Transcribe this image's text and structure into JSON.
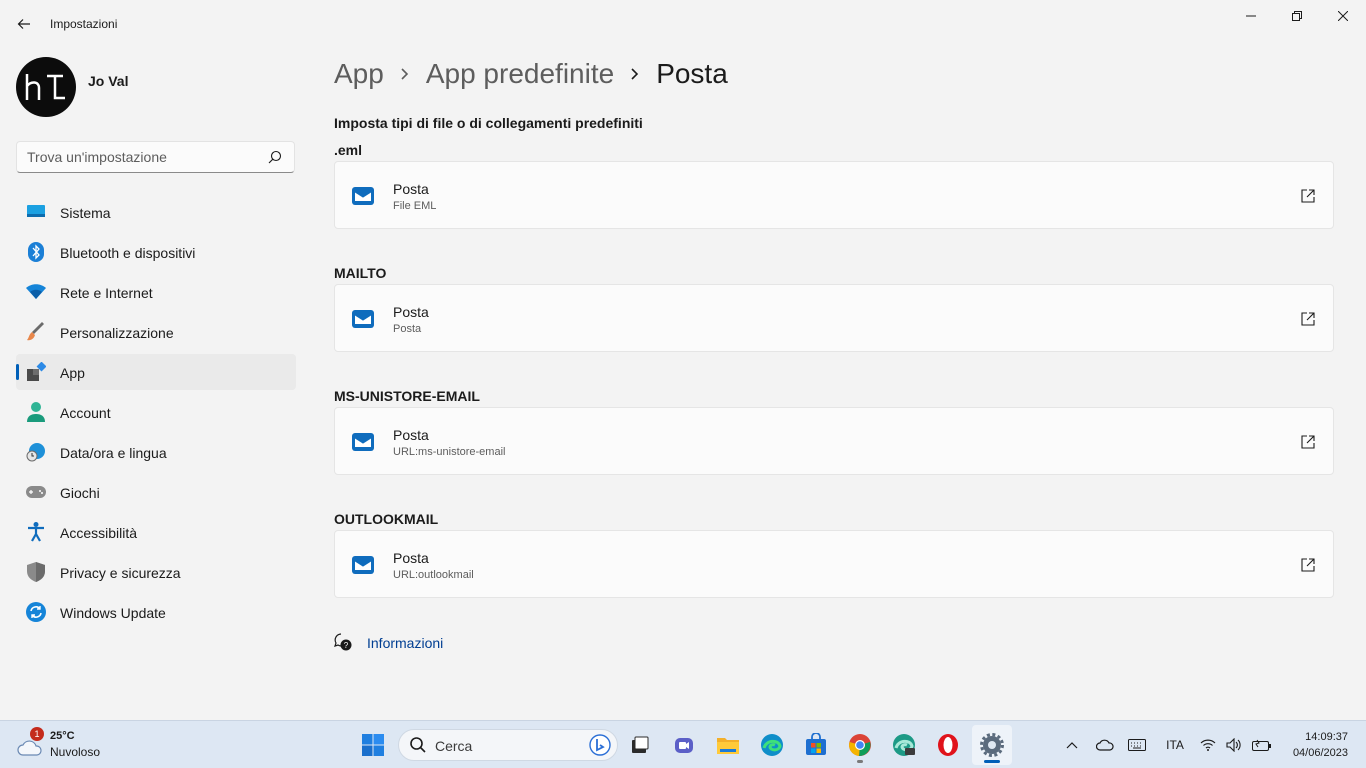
{
  "window": {
    "title": "Impostazioni"
  },
  "profile": {
    "name": "Jo Val"
  },
  "search": {
    "placeholder": "Trova un'impostazione"
  },
  "sidebar": {
    "items": [
      {
        "label": "Sistema",
        "icon": "system-icon"
      },
      {
        "label": "Bluetooth e dispositivi",
        "icon": "bluetooth-icon"
      },
      {
        "label": "Rete e Internet",
        "icon": "wifi-icon"
      },
      {
        "label": "Personalizzazione",
        "icon": "brush-icon"
      },
      {
        "label": "App",
        "icon": "apps-icon",
        "active": true
      },
      {
        "label": "Account",
        "icon": "account-icon"
      },
      {
        "label": "Data/ora e lingua",
        "icon": "time-language-icon"
      },
      {
        "label": "Giochi",
        "icon": "gamepad-icon"
      },
      {
        "label": "Accessibilità",
        "icon": "accessibility-icon"
      },
      {
        "label": "Privacy e sicurezza",
        "icon": "shield-icon"
      },
      {
        "label": "Windows Update",
        "icon": "update-icon"
      }
    ]
  },
  "breadcrumb": {
    "items": [
      "App",
      "App predefinite",
      "Posta"
    ]
  },
  "main": {
    "section_title": "Imposta tipi di file o di collegamenti predefiniti",
    "groups": [
      {
        "label": ".eml",
        "app": "Posta",
        "detail": "File EML"
      },
      {
        "label": "MAILTO",
        "app": "Posta",
        "detail": "Posta"
      },
      {
        "label": "MS-UNISTORE-EMAIL",
        "app": "Posta",
        "detail": "URL:ms-unistore-email"
      },
      {
        "label": "OUTLOOKMAIL",
        "app": "Posta",
        "detail": "URL:outlookmail"
      }
    ],
    "info_link": "Informazioni"
  },
  "taskbar": {
    "weather": {
      "temp": "25°C",
      "condition": "Nuvoloso",
      "badge": "1"
    },
    "search_label": "Cerca",
    "language": "ITA",
    "time": "14:09:37",
    "date": "04/06/2023"
  },
  "colors": {
    "accent": "#005fb8",
    "link": "#003e92",
    "mail_icon": "#0f6cbd"
  }
}
